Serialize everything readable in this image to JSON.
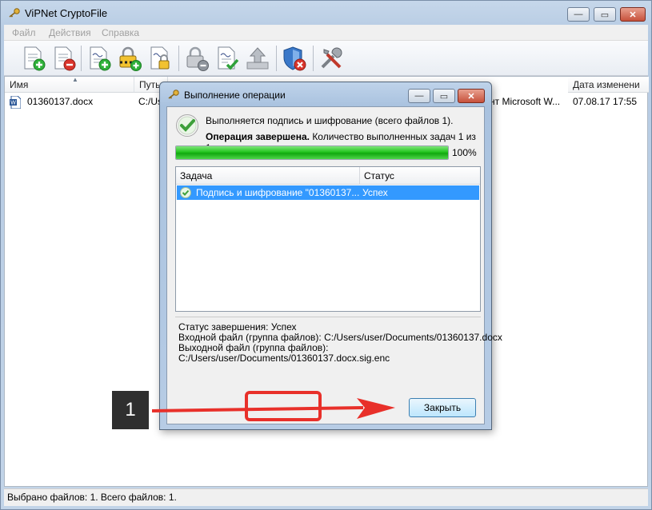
{
  "window": {
    "title": "ViPNet CryptoFile",
    "controls": [
      "—",
      "▭",
      "✕"
    ]
  },
  "menu": {
    "items": [
      "Файл",
      "Действия",
      "Справка"
    ]
  },
  "toolbar": {
    "icons": [
      "sign-add-icon",
      "sign-remove-icon",
      "sign-doc-add-icon",
      "encrypt-add-icon",
      "encrypt-lock-icon",
      "decrypt-remove-icon",
      "verify-check-icon",
      "upload-icon",
      "shield-remove-icon",
      "tools-icon"
    ]
  },
  "filelist": {
    "columns": [
      "Имя",
      "Путь",
      "Дата изменени"
    ],
    "row": {
      "name": "01360137.docx",
      "path": "C:/Us",
      "type": "нт Microsoft W...",
      "date": "07.08.17 17:55"
    }
  },
  "status_bar": {
    "text": "Выбрано файлов: 1. Всего файлов: 1."
  },
  "dialog": {
    "title": "Выполнение операции",
    "message": "Выполняется подпись и шифрование (всего файлов 1).",
    "result_bold": "Операция завершена.",
    "result_rest": " Количество выполненных задач 1 из 1.",
    "progress": 100,
    "progress_label": "100%",
    "columns": {
      "task": "Задача",
      "status": "Статус"
    },
    "tasks": [
      {
        "name": "Подпись и шифрование \"01360137...",
        "status": "Успех"
      }
    ],
    "details": [
      "Статус завершения: Успех",
      "Входной файл (группа файлов): C:/Users/user/Documents/01360137.docx",
      "Выходной файл (группа файлов):",
      "C:/Users/user/Documents/01360137.docx.sig.enc"
    ],
    "close_label": "Закрыть"
  },
  "annotation": {
    "step": "1"
  }
}
